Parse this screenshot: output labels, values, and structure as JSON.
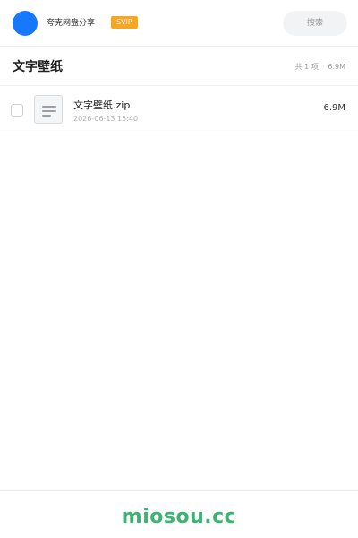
{
  "header": {
    "username": "夸克网盘分享",
    "badge": "SVIP",
    "search_placeholder": "搜索"
  },
  "folder": {
    "title": "文字壁纸",
    "count": "共 1 项",
    "total_size": "6.9M"
  },
  "files": [
    {
      "name": "文字壁纸.zip",
      "date": "2026-06-13 15:40",
      "size": "6.9M",
      "icon": "document-icon"
    }
  ],
  "footer": {
    "brand": "miosou.cc"
  },
  "colors": {
    "avatar": "#1677ff",
    "badge": "#f5a623",
    "brand": "#3cb371"
  }
}
